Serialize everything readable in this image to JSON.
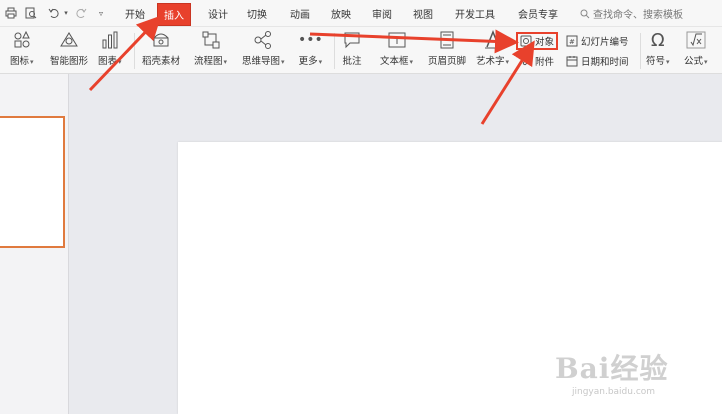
{
  "tabs": [
    {
      "label": "开始"
    },
    {
      "label": "插入"
    },
    {
      "label": "设计"
    },
    {
      "label": "切换"
    },
    {
      "label": "动画"
    },
    {
      "label": "放映"
    },
    {
      "label": "审阅"
    },
    {
      "label": "视图"
    },
    {
      "label": "开发工具"
    },
    {
      "label": "会员专享"
    }
  ],
  "search": {
    "placeholder": "查找命令、搜索模板"
  },
  "ribbon": {
    "icons_label": "图标",
    "smartart_label": "智能图形",
    "chart_label": "图表",
    "daoke_label": "稻壳素材",
    "flowchart_label": "流程图",
    "mindmap_label": "思维导图",
    "more_label": "更多",
    "comment_label": "批注",
    "textbox_label": "文本框",
    "header_footer_label": "页眉页脚",
    "wordart_label": "艺术字",
    "object_label": "对象",
    "attachment_label": "附件",
    "slide_number_label": "幻灯片编号",
    "datetime_label": "日期和时间",
    "symbol_label": "符号",
    "formula_label": "公式"
  },
  "watermark": {
    "logo": "Bai经验",
    "url": "jingyan.baidu.com"
  },
  "annotation_color": "#e8412c"
}
